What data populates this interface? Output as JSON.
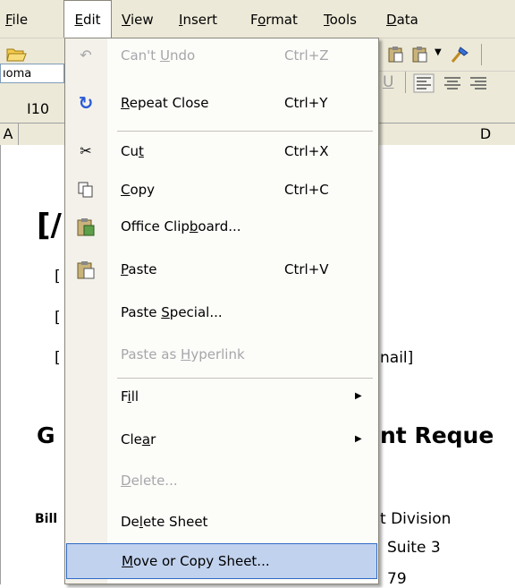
{
  "menubar": {
    "items": [
      "File",
      "Edit",
      "View",
      "Insert",
      "Format",
      "Tools",
      "Data"
    ]
  },
  "toolbar": {
    "font_name": "ıoma"
  },
  "namebox": {
    "value": "I10"
  },
  "columns": {
    "a": "A",
    "d": "D"
  },
  "sheet": {
    "bracket_top": "[/",
    "bracket_rows": [
      "[",
      "[",
      "["
    ],
    "email_tail": "nail]",
    "heading_left": "G",
    "heading_right": "nt Reque",
    "bill_label": "Bill",
    "division": "t Division",
    "suite": "Suite 3",
    "zip": "79"
  },
  "edit_menu": {
    "undo": {
      "label": "Can't Undo",
      "shortcut": "Ctrl+Z",
      "icon": "undo-icon"
    },
    "repeat": {
      "label": "Repeat Close",
      "shortcut": "Ctrl+Y",
      "icon": "repeat-icon"
    },
    "cut": {
      "label": "Cut",
      "shortcut": "Ctrl+X",
      "icon": "scissors-icon"
    },
    "copy": {
      "label": "Copy",
      "shortcut": "Ctrl+C",
      "icon": "copy-icon"
    },
    "office_clipboard": {
      "label": "Office Clipboard...",
      "icon": "clipboard-icon"
    },
    "paste": {
      "label": "Paste",
      "shortcut": "Ctrl+V",
      "icon": "paste-icon"
    },
    "paste_special": {
      "label": "Paste Special..."
    },
    "paste_hyperlink": {
      "label": "Paste as Hyperlink"
    },
    "fill": {
      "label": "Fill"
    },
    "clear": {
      "label": "Clear"
    },
    "delete": {
      "label": "Delete..."
    },
    "delete_sheet": {
      "label": "Delete Sheet"
    },
    "move_copy_sheet": {
      "label": "Move or Copy Sheet..."
    }
  },
  "colors": {
    "highlight": "#c1d2ee",
    "highlight_border": "#316ac5",
    "disabled": "#a7a6aa"
  }
}
